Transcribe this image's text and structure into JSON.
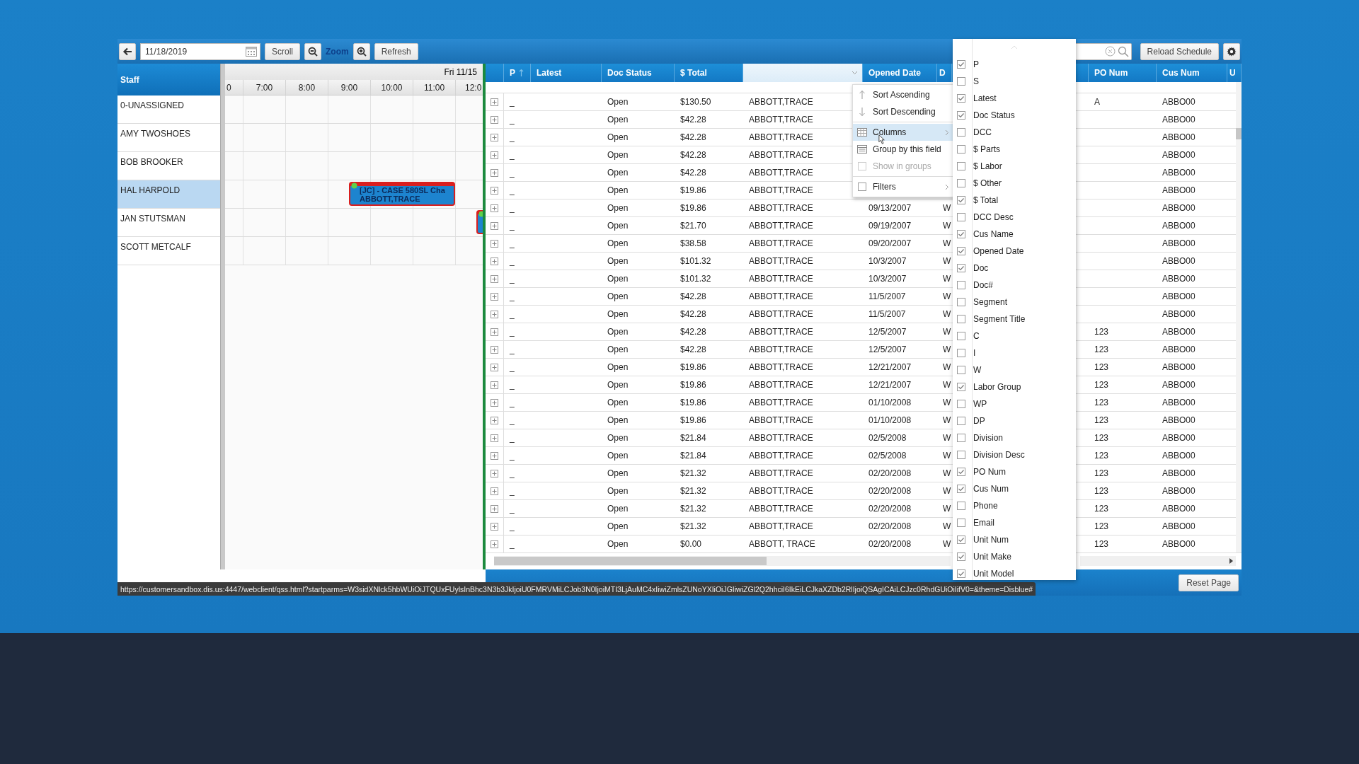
{
  "toolbar": {
    "date": "11/18/2019",
    "scroll_button": "Scroll",
    "zoom_label": "Zoom",
    "refresh_button": "Refresh",
    "reload_button": "Reload Schedule"
  },
  "staff": {
    "title": "Staff",
    "members": [
      {
        "name": "0-UNASSIGNED",
        "selected": false
      },
      {
        "name": "AMY TWOSHOES",
        "selected": false
      },
      {
        "name": "BOB BROOKER",
        "selected": false
      },
      {
        "name": "HAL HARPOLD",
        "selected": true,
        "events": [
          {
            "kind": "appointment",
            "title": "[JC] - CASE 580SL Cha",
            "customer": "ABBOTT,TRACE"
          }
        ]
      },
      {
        "name": "JAN STUTSMAN",
        "selected": false,
        "events": [
          {
            "kind": "appointment"
          }
        ]
      },
      {
        "name": "SCOTT METCALF",
        "selected": false
      }
    ]
  },
  "schedule": {
    "day": "Fri 11/15",
    "times": [
      "0",
      "7:00",
      "8:00",
      "9:00",
      "10:00",
      "11:00",
      "12:0"
    ]
  },
  "grid": {
    "columns": [
      {
        "kind": "expand"
      },
      {
        "kind": "text",
        "label": "P",
        "sorted": true,
        "menu_open": false
      },
      {
        "kind": "text",
        "label": "Latest",
        "sorted": false,
        "menu_open": false
      },
      {
        "kind": "text",
        "label": "Doc Status",
        "sorted": false,
        "menu_open": false
      },
      {
        "kind": "text",
        "label": "$ Total",
        "sorted": false,
        "menu_open": false
      },
      {
        "kind": "text",
        "sorted": false,
        "menu_open": true
      },
      {
        "kind": "text",
        "label": "Opened Date",
        "sorted": false,
        "menu_open": false
      },
      {
        "kind": "text",
        "label": "D",
        "sorted": false,
        "menu_open": false
      },
      {
        "kind": "text",
        "label": "PO Num",
        "sorted": false,
        "menu_open": false
      },
      {
        "kind": "text",
        "label": "Cus Num",
        "sorted": false,
        "menu_open": false
      },
      {
        "kind": "text",
        "label": "U",
        "sorted": false,
        "menu_open": false
      }
    ],
    "rows": [
      {
        "expanded": false,
        "p": "_",
        "status": "Open",
        "total": "$130.50",
        "customer": "ABBOTT,TRACE",
        "po_num": "A",
        "cus_num": "ABBO00"
      },
      {
        "expanded": false,
        "p": "_",
        "status": "Open",
        "total": "$42.28",
        "customer": "ABBOTT,TRACE",
        "cus_num": "ABBO00"
      },
      {
        "expanded": false,
        "p": "_",
        "status": "Open",
        "total": "$42.28",
        "customer": "ABBOTT,TRACE",
        "cus_num": "ABBO00"
      },
      {
        "expanded": false,
        "p": "_",
        "status": "Open",
        "total": "$42.28",
        "customer": "ABBOTT,TRACE",
        "cus_num": "ABBO00"
      },
      {
        "expanded": false,
        "p": "_",
        "status": "Open",
        "total": "$42.28",
        "customer": "ABBOTT,TRACE",
        "cus_num": "ABBO00"
      },
      {
        "expanded": false,
        "p": "_",
        "status": "Open",
        "total": "$19.86",
        "customer": "ABBOTT,TRACE",
        "cus_num": "ABBO00"
      },
      {
        "expanded": false,
        "p": "_",
        "status": "Open",
        "total": "$19.86",
        "customer": "ABBOTT,TRACE",
        "opened": "09/13/2007",
        "doc": "W",
        "cus_num": "ABBO00"
      },
      {
        "expanded": false,
        "p": "_",
        "status": "Open",
        "total": "$21.70",
        "customer": "ABBOTT,TRACE",
        "opened": "09/19/2007",
        "doc": "W",
        "cus_num": "ABBO00"
      },
      {
        "expanded": false,
        "p": "_",
        "status": "Open",
        "total": "$38.58",
        "customer": "ABBOTT,TRACE",
        "opened": "09/20/2007",
        "doc": "W",
        "cus_num": "ABBO00"
      },
      {
        "expanded": false,
        "p": "_",
        "status": "Open",
        "total": "$101.32",
        "customer": "ABBOTT,TRACE",
        "opened": "10/3/2007",
        "doc": "W",
        "cus_num": "ABBO00"
      },
      {
        "expanded": false,
        "p": "_",
        "status": "Open",
        "total": "$101.32",
        "customer": "ABBOTT,TRACE",
        "opened": "10/3/2007",
        "doc": "W",
        "cus_num": "ABBO00"
      },
      {
        "expanded": false,
        "p": "_",
        "status": "Open",
        "total": "$42.28",
        "customer": "ABBOTT,TRACE",
        "opened": "11/5/2007",
        "doc": "W",
        "cus_num": "ABBO00"
      },
      {
        "expanded": false,
        "p": "_",
        "status": "Open",
        "total": "$42.28",
        "customer": "ABBOTT,TRACE",
        "opened": "11/5/2007",
        "doc": "W",
        "cus_num": "ABBO00"
      },
      {
        "expanded": false,
        "p": "_",
        "status": "Open",
        "total": "$42.28",
        "customer": "ABBOTT,TRACE",
        "opened": "12/5/2007",
        "doc": "W",
        "po_num": "123",
        "cus_num": "ABBO00"
      },
      {
        "expanded": false,
        "p": "_",
        "status": "Open",
        "total": "$42.28",
        "customer": "ABBOTT,TRACE",
        "opened": "12/5/2007",
        "doc": "W",
        "po_num": "123",
        "cus_num": "ABBO00"
      },
      {
        "expanded": false,
        "p": "_",
        "status": "Open",
        "total": "$19.86",
        "customer": "ABBOTT,TRACE",
        "opened": "12/21/2007",
        "doc": "W",
        "po_num": "123",
        "cus_num": "ABBO00"
      },
      {
        "expanded": false,
        "p": "_",
        "status": "Open",
        "total": "$19.86",
        "customer": "ABBOTT,TRACE",
        "opened": "12/21/2007",
        "doc": "W",
        "po_num": "123",
        "cus_num": "ABBO00"
      },
      {
        "expanded": false,
        "p": "_",
        "status": "Open",
        "total": "$19.86",
        "customer": "ABBOTT,TRACE",
        "opened": "01/10/2008",
        "doc": "W",
        "po_num": "123",
        "cus_num": "ABBO00"
      },
      {
        "expanded": false,
        "p": "_",
        "status": "Open",
        "total": "$19.86",
        "customer": "ABBOTT,TRACE",
        "opened": "01/10/2008",
        "doc": "W",
        "po_num": "123",
        "cus_num": "ABBO00"
      },
      {
        "expanded": false,
        "p": "_",
        "status": "Open",
        "total": "$21.84",
        "customer": "ABBOTT,TRACE",
        "opened": "02/5/2008",
        "doc": "W",
        "po_num": "123",
        "cus_num": "ABBO00"
      },
      {
        "expanded": false,
        "p": "_",
        "status": "Open",
        "total": "$21.84",
        "customer": "ABBOTT,TRACE",
        "opened": "02/5/2008",
        "doc": "W",
        "po_num": "123",
        "cus_num": "ABBO00"
      },
      {
        "expanded": false,
        "p": "_",
        "status": "Open",
        "total": "$21.32",
        "customer": "ABBOTT,TRACE",
        "opened": "02/20/2008",
        "doc": "W",
        "po_num": "123",
        "cus_num": "ABBO00"
      },
      {
        "expanded": false,
        "p": "_",
        "status": "Open",
        "total": "$21.32",
        "customer": "ABBOTT,TRACE",
        "opened": "02/20/2008",
        "doc": "W",
        "po_num": "123",
        "cus_num": "ABBO00"
      },
      {
        "expanded": false,
        "p": "_",
        "status": "Open",
        "total": "$21.32",
        "customer": "ABBOTT,TRACE",
        "opened": "02/20/2008",
        "doc": "W",
        "po_num": "123",
        "cus_num": "ABBO00"
      },
      {
        "expanded": false,
        "p": "_",
        "status": "Open",
        "total": "$21.32",
        "customer": "ABBOTT,TRACE",
        "opened": "02/20/2008",
        "doc": "W",
        "po_num": "123",
        "cus_num": "ABBO00"
      },
      {
        "expanded": false,
        "p": "_",
        "status": "Open",
        "total": "$0.00",
        "customer": "ABBOTT, TRACE",
        "opened": "02/20/2008",
        "doc": "W",
        "po_num": "123",
        "cus_num": "ABBO00"
      }
    ]
  },
  "context_menu": {
    "items": [
      {
        "kind": "sort-ascending",
        "label": "Sort Ascending",
        "highlighted": false,
        "disabled": false,
        "submenu": false
      },
      {
        "kind": "sort-descending",
        "label": "Sort Descending",
        "highlighted": false,
        "disabled": false,
        "submenu": false
      },
      {
        "kind": "separator"
      },
      {
        "kind": "columns",
        "label": "Columns",
        "highlighted": true,
        "disabled": false,
        "submenu": true
      },
      {
        "kind": "group",
        "label": "Group by this field",
        "highlighted": false,
        "disabled": false,
        "submenu": false
      },
      {
        "kind": "checkbox",
        "label": "Show in groups",
        "highlighted": false,
        "disabled": true,
        "submenu": false
      },
      {
        "kind": "separator"
      },
      {
        "kind": "checkbox",
        "label": "Filters",
        "highlighted": false,
        "disabled": false,
        "submenu": true
      }
    ]
  },
  "column_chooser": {
    "items": [
      {
        "label": "P",
        "checked": true
      },
      {
        "label": "S",
        "checked": false
      },
      {
        "label": "Latest",
        "checked": true
      },
      {
        "label": "Doc Status",
        "checked": true
      },
      {
        "label": "DCC",
        "checked": false
      },
      {
        "label": "$ Parts",
        "checked": false
      },
      {
        "label": "$ Labor",
        "checked": false
      },
      {
        "label": "$ Other",
        "checked": false
      },
      {
        "label": "$ Total",
        "checked": true
      },
      {
        "label": "DCC Desc",
        "checked": false
      },
      {
        "label": "Cus Name",
        "checked": true
      },
      {
        "label": "Opened Date",
        "checked": true
      },
      {
        "label": "Doc",
        "checked": true
      },
      {
        "label": "Doc#",
        "checked": false
      },
      {
        "label": "Segment",
        "checked": false
      },
      {
        "label": "Segment Title",
        "checked": false
      },
      {
        "label": "C",
        "checked": false
      },
      {
        "label": "I",
        "checked": false
      },
      {
        "label": "W",
        "checked": false
      },
      {
        "label": "Labor Group",
        "checked": true
      },
      {
        "label": "WP",
        "checked": false
      },
      {
        "label": "DP",
        "checked": false
      },
      {
        "label": "Division",
        "checked": false
      },
      {
        "label": "Division Desc",
        "checked": false
      },
      {
        "label": "PO Num",
        "checked": true
      },
      {
        "label": "Cus Num",
        "checked": true
      },
      {
        "label": "Phone",
        "checked": false
      },
      {
        "label": "Email",
        "checked": false
      },
      {
        "label": "Unit Num",
        "checked": true
      },
      {
        "label": "Unit Make",
        "checked": true
      },
      {
        "label": "Unit Model",
        "checked": true
      }
    ]
  },
  "footer": {
    "reset_button": "Reset Page",
    "status_url": "https://customersandbox.dis.us:4447/webclient/qss.html?startparms=W3sidXNlck5hbWUiOiJTQUxFUylsInBhc3N3b3JkIjoiU0FMRVMiLCJob3N0IjoiMTI3LjAuMC4xIiwiZmlsZUNoYXIiOiJGIiwiZGl2Q2hhciI6IkEiLCJkaXZDb2RlIjoiQSAgICAiLCJzc0RhdGUiOiIifV0=&theme=Disblue#"
  }
}
